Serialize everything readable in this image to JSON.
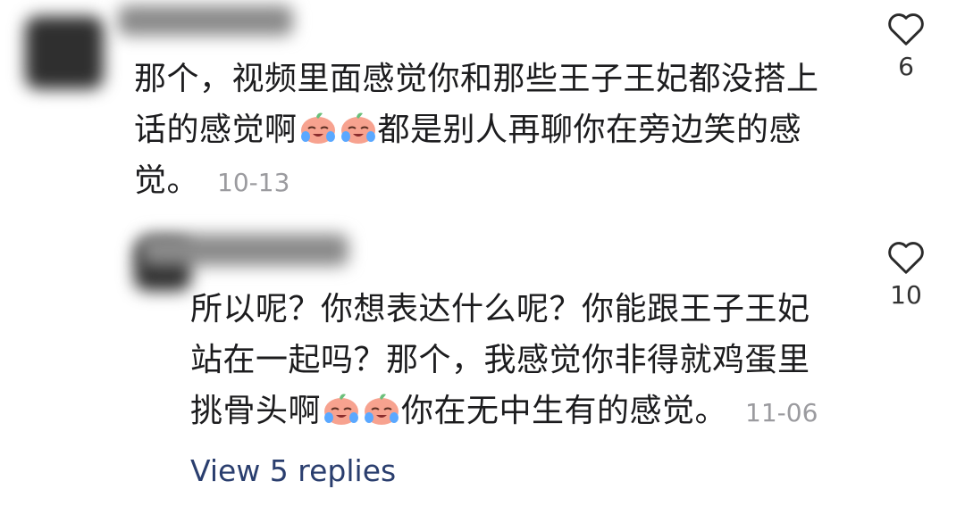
{
  "comment1": {
    "lines": [
      "那个，视频里面感觉你和那些王子王妃都没搭上",
      "话的感觉啊",
      "都是别人再聊你在旁边笑的感",
      "觉。"
    ],
    "date": "10-13",
    "likes": "6"
  },
  "comment2": {
    "lines": [
      "所以呢？你想表达什么呢？你能跟王子王妃",
      "站在一起吗？那个，我感觉你非得就鸡蛋里",
      "挑骨头啊",
      "你在无中生有的感觉。"
    ],
    "date": "11-06",
    "likes": "10",
    "view_replies": "View 5 replies"
  },
  "icons": {
    "like": "heart-outline-icon",
    "emoji": "crying-laughing-peach-emoji"
  },
  "colors": {
    "text": "#1c1c1e",
    "date": "#9b9b9f",
    "link": "#2a3e6e"
  }
}
